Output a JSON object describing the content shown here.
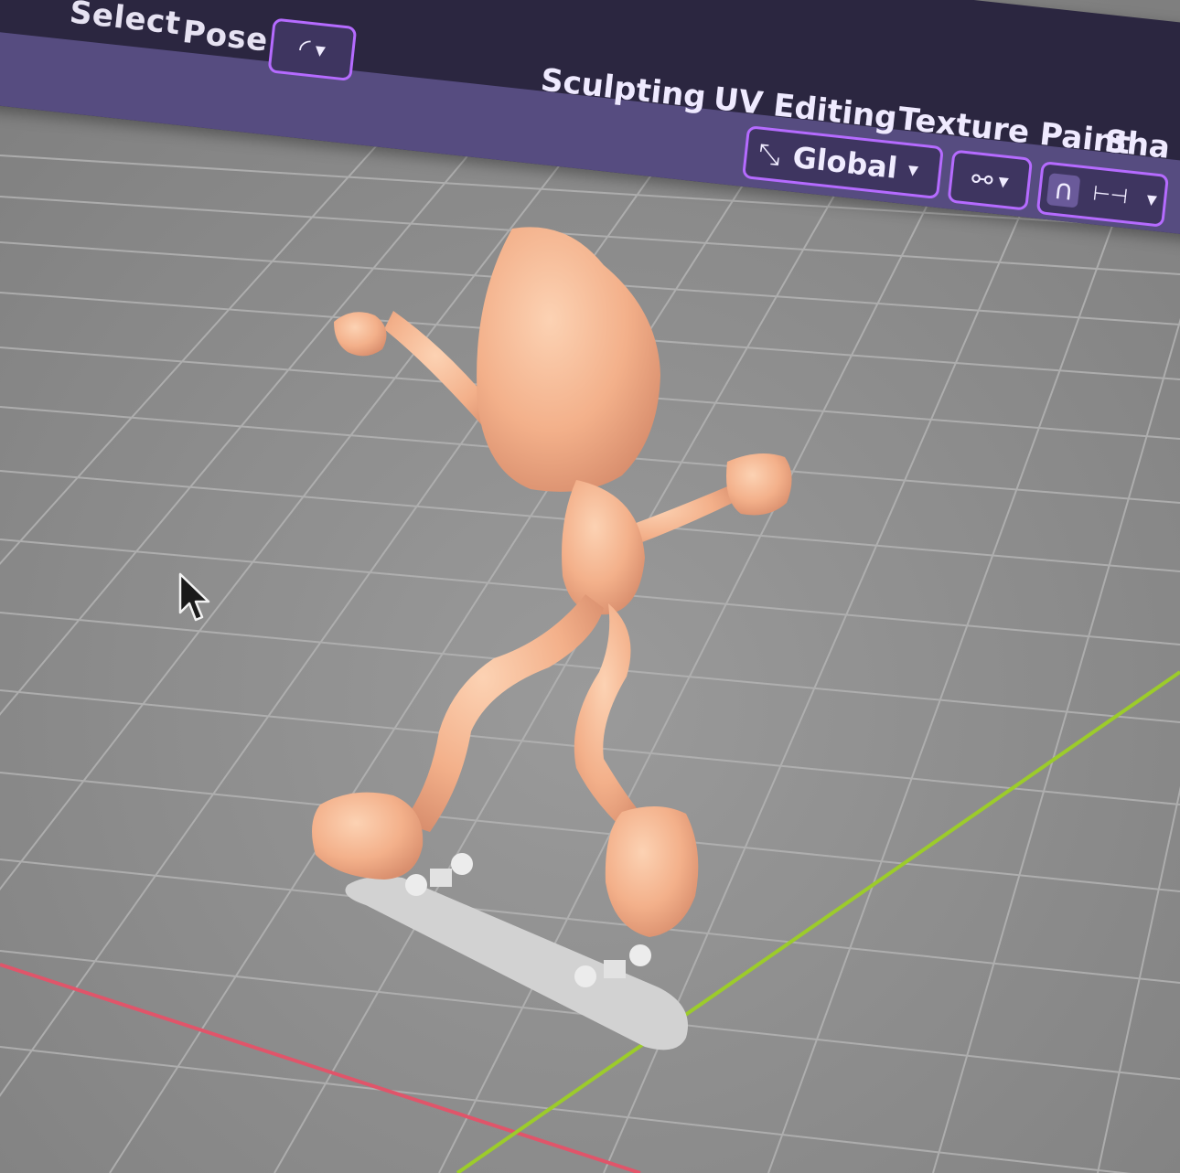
{
  "header": {
    "menu": {
      "select_label": "Select",
      "pose_label": "Pose"
    },
    "workspace_tabs": [
      {
        "label": "Sculpting"
      },
      {
        "label": "UV Editing"
      },
      {
        "label": "Texture Paint"
      },
      {
        "label": "Sha"
      }
    ],
    "toolbar": {
      "transform_orientation": "Global",
      "icons": {
        "curve": "curve-icon",
        "orientation": "transform-orientation-icon",
        "pivot": "link-icon",
        "snap": "magnet-icon",
        "snap_target": "snap-increment-icon"
      }
    }
  },
  "viewport": {
    "colors": {
      "floor": "#8f8f8f",
      "grid": "#b4b4b4",
      "x_axis": "#e0556a",
      "y_axis": "#9ccc2a",
      "character": "#f3b58f",
      "skateboard": "#cfcfcf",
      "accent": "#b56bff"
    }
  }
}
